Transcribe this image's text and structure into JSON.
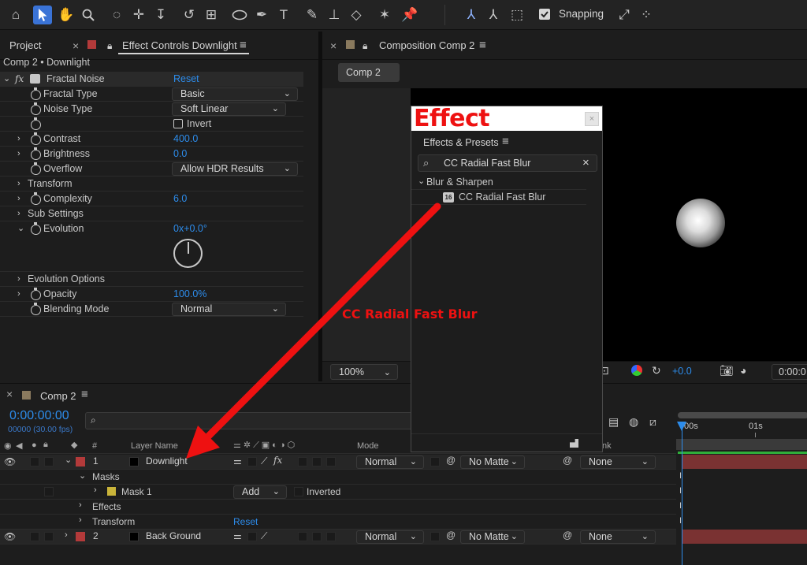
{
  "toolbar": {
    "snapping_label": "Snapping",
    "snapping_checked": true
  },
  "effect_controls": {
    "tab_project": "Project",
    "tab_effect_controls": "Effect Controls Downlight",
    "breadcrumb": "Comp 2 • Downlight",
    "effect_name": "Fractal Noise",
    "reset_label": "Reset",
    "properties": [
      {
        "label": "Fractal Type",
        "value": "Basic"
      },
      {
        "label": "Noise Type",
        "value": "Soft Linear"
      },
      {
        "label": "Invert",
        "value": ""
      },
      {
        "label": "Contrast",
        "value": "400.0"
      },
      {
        "label": "Brightness",
        "value": "0.0"
      },
      {
        "label": "Overflow",
        "value": "Allow HDR Results"
      },
      {
        "label": "Transform",
        "value": ""
      },
      {
        "label": "Complexity",
        "value": "6.0"
      },
      {
        "label": "Sub Settings",
        "value": ""
      },
      {
        "label": "Evolution",
        "value": "0x+0.0°"
      },
      {
        "label": "Evolution Options",
        "value": ""
      },
      {
        "label": "Opacity",
        "value": "100.0%"
      },
      {
        "label": "Blending Mode",
        "value": "Normal"
      }
    ]
  },
  "composition": {
    "tab_label": "Composition Comp 2",
    "comp_chip": "Comp 2",
    "zoom": "100%",
    "exposure": "+0.0",
    "timecode": "0:00:0"
  },
  "effects_presets": {
    "banner_text": "Effect",
    "title": "Effects & Presets",
    "search_value": "CC Radial Fast Blur",
    "category": "Blur & Sharpen",
    "item": "CC Radial Fast Blur"
  },
  "annotation": {
    "text": "CC Radial Fast Blur"
  },
  "timeline": {
    "tab_label": "Comp 2",
    "timecode": "0:00:00:00",
    "frames": "00000 (30.00 fps)",
    "search_placeholder": "",
    "col_hash": "#",
    "col_layer_name": "Layer Name",
    "col_mode": "Mode",
    "col_parent_frag": "nk",
    "ruler_start": "00s",
    "ruler_1s": "01s",
    "layers": [
      {
        "num": "1",
        "name": "Downlight",
        "mode": "Normal",
        "matte": "No Matte",
        "parent": "None"
      },
      {
        "num": "2",
        "name": "Back Ground",
        "mode": "Normal",
        "matte": "No Matte",
        "parent": "None"
      }
    ],
    "masks_label": "Masks",
    "mask1_label": "Mask 1",
    "mask1_mode": "Add",
    "mask1_inverted": "Inverted",
    "effects_label": "Effects",
    "transform_label": "Transform",
    "transform_reset": "Reset"
  },
  "colors": {
    "accent_blue": "#2d8ceb",
    "layer_red": "#b33a3a",
    "arrow_red": "#ee1111"
  }
}
